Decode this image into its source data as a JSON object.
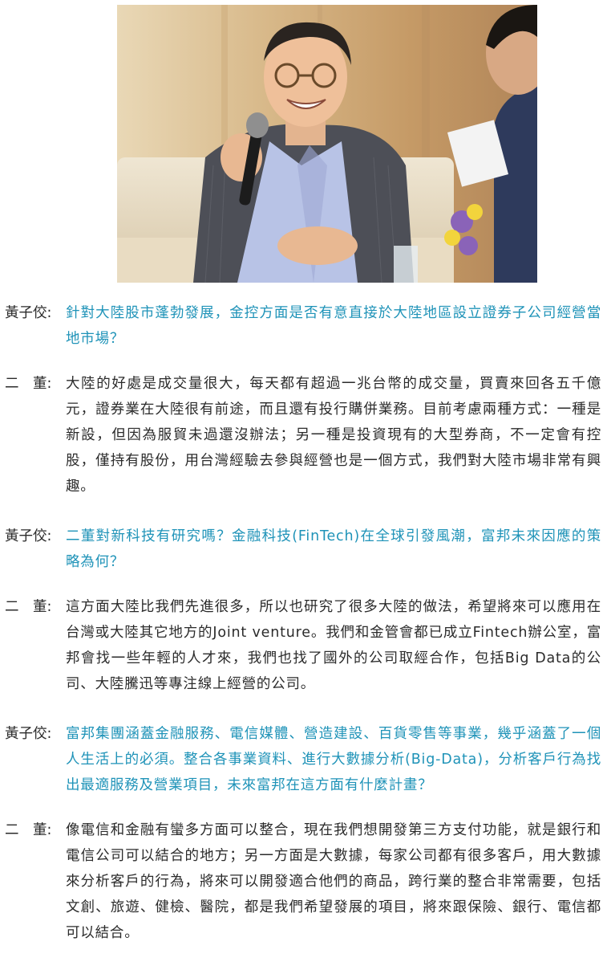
{
  "photo": {
    "alt_icon": "interview-photo"
  },
  "colors": {
    "question": "#1f93b8",
    "answer": "#2b2b2b"
  },
  "dialogue": [
    {
      "type": "question",
      "speaker": "黃子佼:",
      "text": "針對大陸股市蓬勃發展，金控方面是否有意直接於大陸地區設立證券子公司經營當地市場？"
    },
    {
      "type": "answer",
      "speaker": "二　董:",
      "text": "大陸的好處是成交量很大，每天都有超過一兆台幣的成交量，買賣來回各五千億元，證券業在大陸很有前途，而且還有投行購併業務。目前考慮兩種方式：一種是新設，但因為服貿未過還沒辦法；另一種是投資現有的大型券商，不一定會有控股，僅持有股份，用台灣經驗去參與經營也是一個方式，我們對大陸市場非常有興趣。"
    },
    {
      "type": "question",
      "speaker": "黃子佼:",
      "text": "二董對新科技有研究嗎？金融科技(FinTech)在全球引發風潮，富邦未來因應的策略為何？"
    },
    {
      "type": "answer",
      "speaker": "二　董:",
      "text": "這方面大陸比我們先進很多，所以也研究了很多大陸的做法，希望將來可以應用在台灣或大陸其它地方的Joint venture。我們和金管會都已成立Fintech辦公室，富邦會找一些年輕的人才來，我們也找了國外的公司取經合作，包括Big Data的公司、大陸騰迅等專注線上經營的公司。"
    },
    {
      "type": "question",
      "speaker": "黃子佼:",
      "text": "富邦集團涵蓋金融服務、電信媒體、營造建設、百貨零售等事業，幾乎涵蓋了一個人生活上的必須。整合各事業資料、進行大數據分析(Big-Data)，分析客戶行為找出最適服務及營業項目，未來富邦在這方面有什麼計畫？"
    },
    {
      "type": "answer",
      "speaker": "二　董:",
      "text": "像電信和金融有蠻多方面可以整合，現在我們想開發第三方支付功能，就是銀行和電信公司可以結合的地方；另一方面是大數據，每家公司都有很多客戶，用大數據來分析客戶的行為，將來可以開發適合他們的商品，跨行業的整合非常需要，包括文創、旅遊、健檢、醫院，都是我們希望發展的項目，將來跟保險、銀行、電信都可以結合。"
    }
  ]
}
